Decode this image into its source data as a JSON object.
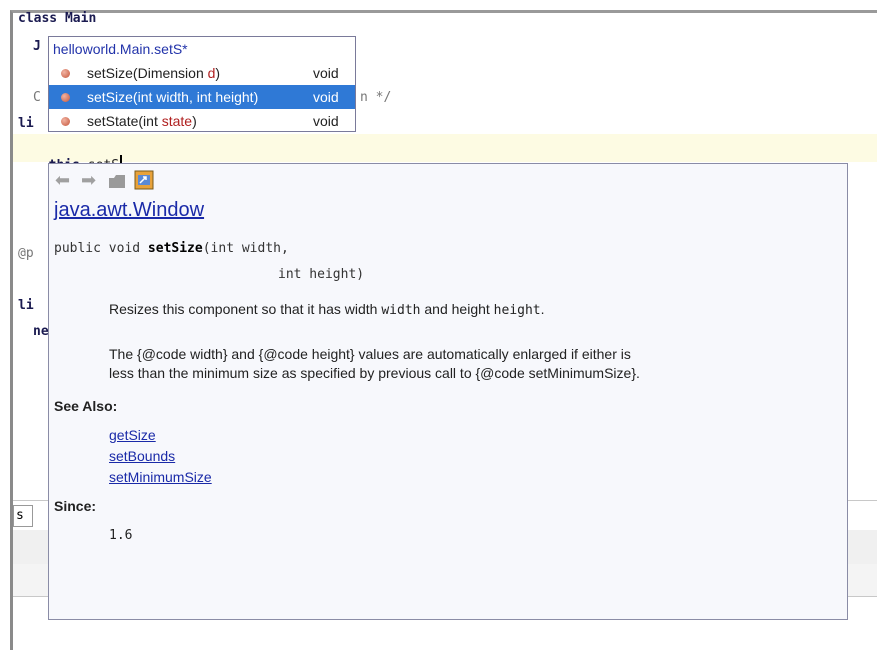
{
  "editor": {
    "line_class": "class Main",
    "line_j_fragment": "J",
    "line_comment_fragment": "C",
    "line_comment_tail": "n */",
    "line_public_fragment1": "li",
    "line_this": "this.",
    "line_typed": "setS",
    "line_param_fragment": "@p",
    "line_public_fragment2": "li",
    "line_ne_fragment": "ne"
  },
  "bottom_panel": {
    "tab_fragment": "s"
  },
  "completion": {
    "title": "helloworld.Main.setS*",
    "items": [
      {
        "name": "setSize",
        "open": "(",
        "ptype": "Dimension ",
        "pname": "d",
        "close": ")",
        "ret": "void",
        "selected": false
      },
      {
        "name": "setSize",
        "open": "(",
        "ptype": "int width, int height",
        "pname": "",
        "close": ")",
        "ret": "void",
        "selected": true
      },
      {
        "name": "setState",
        "open": "(",
        "ptype": "int ",
        "pname": "state",
        "close": ")",
        "ret": "void",
        "selected": false
      }
    ]
  },
  "javadoc": {
    "toolbar_icons": [
      "back-arrow-icon",
      "forward-arrow-icon",
      "open-source-icon",
      "external-browser-icon"
    ],
    "class_link": "java.awt.Window",
    "sig_prefix": "public void ",
    "sig_method": "setSize",
    "sig_params_line1": "(int width,",
    "sig_params_line2": "int height)",
    "para1_a": "Resizes this component so that it has width ",
    "para1_code1": "width",
    "para1_b": " and height ",
    "para1_code2": "height",
    "para1_c": ".",
    "para2_line1": "The {@code width} and {@code height} values are automatically enlarged if either is",
    "para2_line2": "less than the minimum size as specified by previous call to {@code setMinimumSize}.",
    "see_also_heading": "See Also:",
    "see_also": [
      "getSize",
      "setBounds",
      "setMinimumSize"
    ],
    "since_heading": "Since:",
    "since_value": "1.6"
  }
}
